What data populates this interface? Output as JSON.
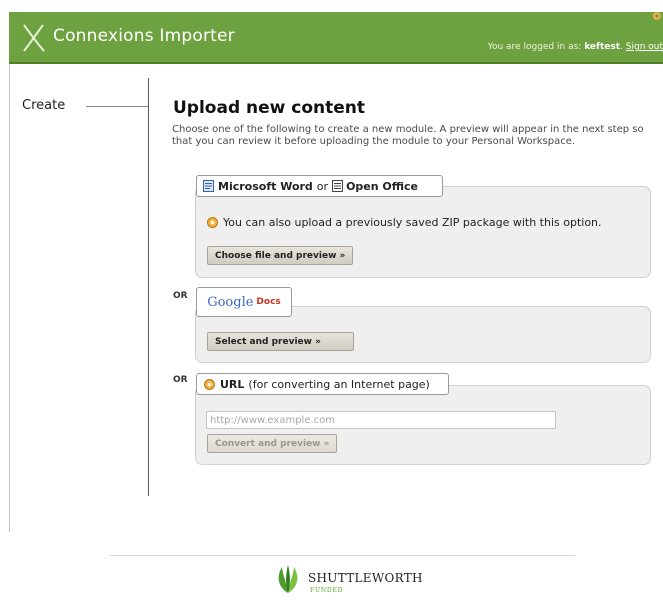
{
  "header": {
    "app_title": "Connexions Importer",
    "logged_in_prefix": "You are logged in as:",
    "username": "keftest",
    "sign_out": "Sign out",
    "bar_color": "#6ea240"
  },
  "sidebar": {
    "create_label": "Create"
  },
  "main": {
    "heading": "Upload new content",
    "intro": "Choose one of the following to create a new module. A preview will appear in the next step so that you can review it before uploading the module to your Personal Workspace.",
    "office": {
      "word": "Microsoft Word",
      "or": "or",
      "openoffice": "Open Office",
      "zip_note": "You can also upload a previously saved ZIP package with this option.",
      "button": "Choose file and preview »"
    },
    "or_label": "OR",
    "google": {
      "google": "Google",
      "docs": "Docs",
      "button": "Select and preview »"
    },
    "url": {
      "label": "URL",
      "desc": "(for converting an Internet page)",
      "placeholder": "http://www.example.com",
      "button": "Convert and preview »"
    }
  },
  "footer": {
    "brand": "SHUTTLEWORTH",
    "sub": "FUNDED"
  },
  "icons": {
    "logo": "cnx-x-logo-icon",
    "word": "word-document-icon",
    "openoffice": "openoffice-document-icon",
    "zip": "zip-package-icon",
    "url": "url-gear-icon",
    "shuttleworth": "shuttleworth-leaf-icon"
  }
}
